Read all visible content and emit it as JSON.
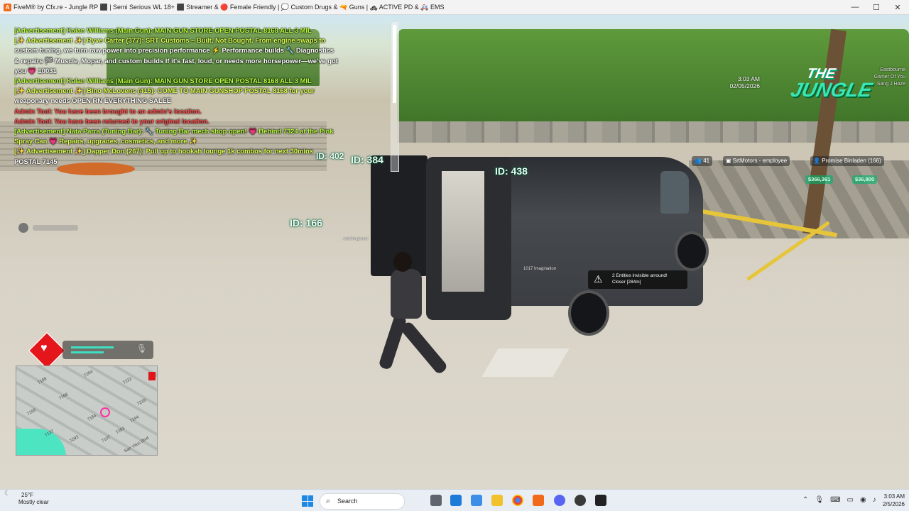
{
  "window": {
    "title": "FiveM® by Cfx.re - Jungle RP ⬛ | Semi Serious WL 18+ ⬛ Streamer & 🔴 Female Friendly | 💭 Custom Drugs & 🔫 Guns | 🚓 ACTIVE PD & 🚑 EMS",
    "app_icon": "fivem-icon",
    "controls": [
      "—",
      "☐",
      "✕"
    ]
  },
  "chat": {
    "lines": [
      {
        "text": "[Advertisement] Kalan Williams (Main Gun): MAIN GUN STORE OPEN POSTAL 8168 ALL 3 MIL",
        "style": "c-ad"
      },
      {
        "text": "[✨ Advertisement ✨] Ryve Carter (377): SRT Customs – Built, Not Bought. From engine swaps to",
        "style": "c-ad2"
      },
      {
        "text": "custom tuning, we turn raw power into precision performance ⚡ Performance builds 🔧 Diagnostics",
        "style": "c-wh"
      },
      {
        "text": "& repairs 🏁 Muscle, Mopar, and custom builds If it's fast, loud, or needs more horsepower—we've got",
        "style": "c-wh"
      },
      {
        "text": "you 💗 10031",
        "style": "c-wh"
      },
      {
        "text": "[Advertisement] Kalan Williams (Main Gun): MAIN GUN STORE OPEN POSTAL 8168 ALL 3 MIL",
        "style": "c-ad"
      },
      {
        "text": "[✨ Advertisement ✨] Bino McLovens (415): COME TO MAIN GUNSHOP POSTAL 8168 for your",
        "style": "c-ad2"
      },
      {
        "text": "weaponary needs OPEN RN EVERYTHING SALEE",
        "style": "c-wh"
      },
      {
        "text": "Admin Tool: You have been brought to an admin's location.",
        "style": "c-red"
      },
      {
        "text": "Admin Tool: You have been returned to your original location.",
        "style": "c-red"
      },
      {
        "text": "[Advertisement] Nata Parra (Tuning Bar): 🔧 Tuning Bar mech shop open! 💗 Behind 7324 at the Pink",
        "style": "c-ad"
      },
      {
        "text": "Spray Can 💗 Repairs, upgrades, cosmetics, and more ✨",
        "style": "c-ad2"
      },
      {
        "text": "[✨ Advertisement ✨] Dapper Don (267): Pull up to hookah lounge 1k combos for next 30mins",
        "style": "c-ad2"
      },
      {
        "text": "POSTAL 7145",
        "style": "c-wh"
      }
    ]
  },
  "ids": {
    "a": "ID: 402",
    "b": "ID: 384",
    "c": "ID: 438",
    "d": "ID: 166"
  },
  "world_labels": {
    "player_tag": "catchingtoast",
    "van_tag": "1017 Imagination"
  },
  "notification": {
    "line1": "2 Entities invisible arround!",
    "line2": "Closer [284m]"
  },
  "clock": {
    "time": "3:03 AM",
    "date": "02/05/2026"
  },
  "logo": {
    "line1": "THE",
    "line2": "JUNGLE"
  },
  "top_right_info": [
    "Eastbourne",
    "Gamer Of You",
    "Sang J Haze"
  ],
  "player_list": {
    "count": "41",
    "job": "SrtMotors - employee",
    "name": "Promise Binladen (166)",
    "cash": "$366,361",
    "bank": "$36,800"
  },
  "minimap": {
    "labels": [
      "7188",
      "7204",
      "7222",
      "7168",
      "7239",
      "7156",
      "7184",
      "7283",
      "7137",
      "7194",
      "7107",
      "7293",
      "San Vitus Blvd"
    ]
  },
  "taskbar": {
    "temperature": "25°F",
    "weather": "Mostly clear",
    "search_placeholder": "Search",
    "time": "3:03 AM",
    "date": "2/5/2026"
  },
  "colors": {
    "accent": "#39e6b6",
    "health": "#e4161b",
    "ad_text": "#b8ff3a"
  }
}
